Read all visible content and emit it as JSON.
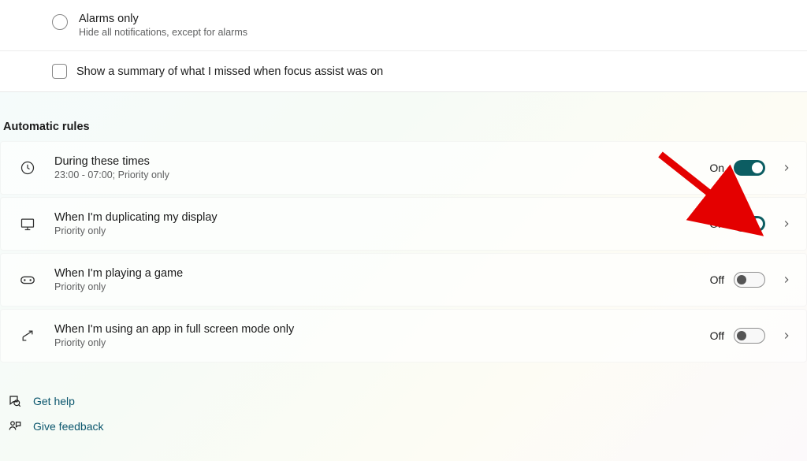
{
  "priority": {
    "alarms_only": {
      "title": "Alarms only",
      "subtitle": "Hide all notifications, except for alarms"
    },
    "summary_checkbox_label": "Show a summary of what I missed when focus assist was on"
  },
  "automatic_rules": {
    "heading": "Automatic rules",
    "items": [
      {
        "title": "During these times",
        "subtitle": "23:00 - 07:00; Priority only",
        "state_label": "On",
        "on": true
      },
      {
        "title": "When I'm duplicating my display",
        "subtitle": "Priority only",
        "state_label": "On",
        "on": true
      },
      {
        "title": "When I'm playing a game",
        "subtitle": "Priority only",
        "state_label": "Off",
        "on": false
      },
      {
        "title": "When I'm using an app in full screen mode only",
        "subtitle": "Priority only",
        "state_label": "Off",
        "on": false
      }
    ]
  },
  "footer": {
    "get_help": "Get help",
    "give_feedback": "Give feedback"
  }
}
